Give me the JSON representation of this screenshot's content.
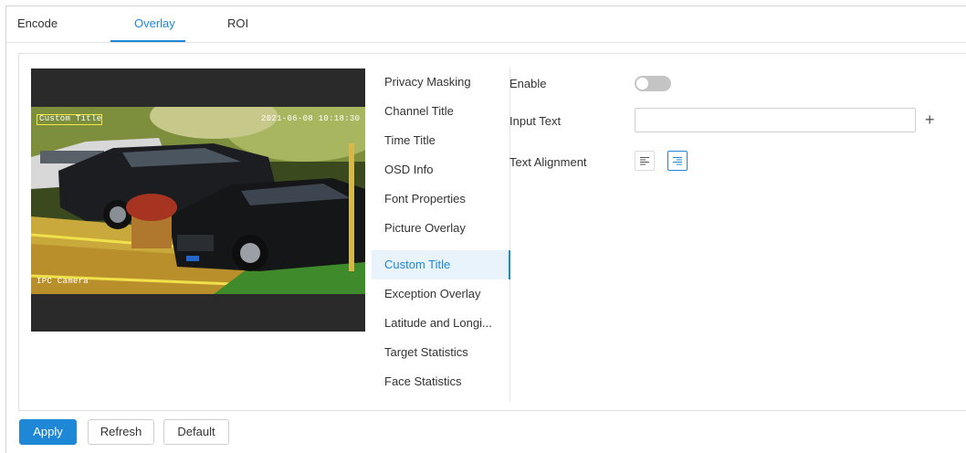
{
  "tabs": [
    {
      "label": "Encode"
    },
    {
      "label": "Overlay"
    },
    {
      "label": "ROI"
    }
  ],
  "active_tab": "Overlay",
  "preview": {
    "osd_channel_title": "Custom Title",
    "osd_time": "2021-06-08 10:18:30",
    "osd_bottom_left": "IPC Camera"
  },
  "menu": {
    "items": [
      {
        "label": "Privacy Masking"
      },
      {
        "label": "Channel Title"
      },
      {
        "label": "Time Title"
      },
      {
        "label": "OSD Info"
      },
      {
        "label": "Font Properties"
      },
      {
        "label": "Picture Overlay"
      },
      {
        "label": "Custom Title"
      },
      {
        "label": "Exception Overlay"
      },
      {
        "label": "Latitude and Longi..."
      },
      {
        "label": "Target Statistics"
      },
      {
        "label": "Face Statistics"
      }
    ],
    "active": "Custom Title"
  },
  "form": {
    "enable_label": "Enable",
    "enable_state": "off",
    "input_text_label": "Input Text",
    "input_text_value": "",
    "add_symbol": "+",
    "text_alignment_label": "Text Alignment",
    "alignment_selected": "right"
  },
  "buttons": {
    "apply": "Apply",
    "refresh": "Refresh",
    "default": "Default"
  },
  "colors": {
    "accent": "#1e88d7",
    "toggle_off": "#c4c4c4"
  }
}
